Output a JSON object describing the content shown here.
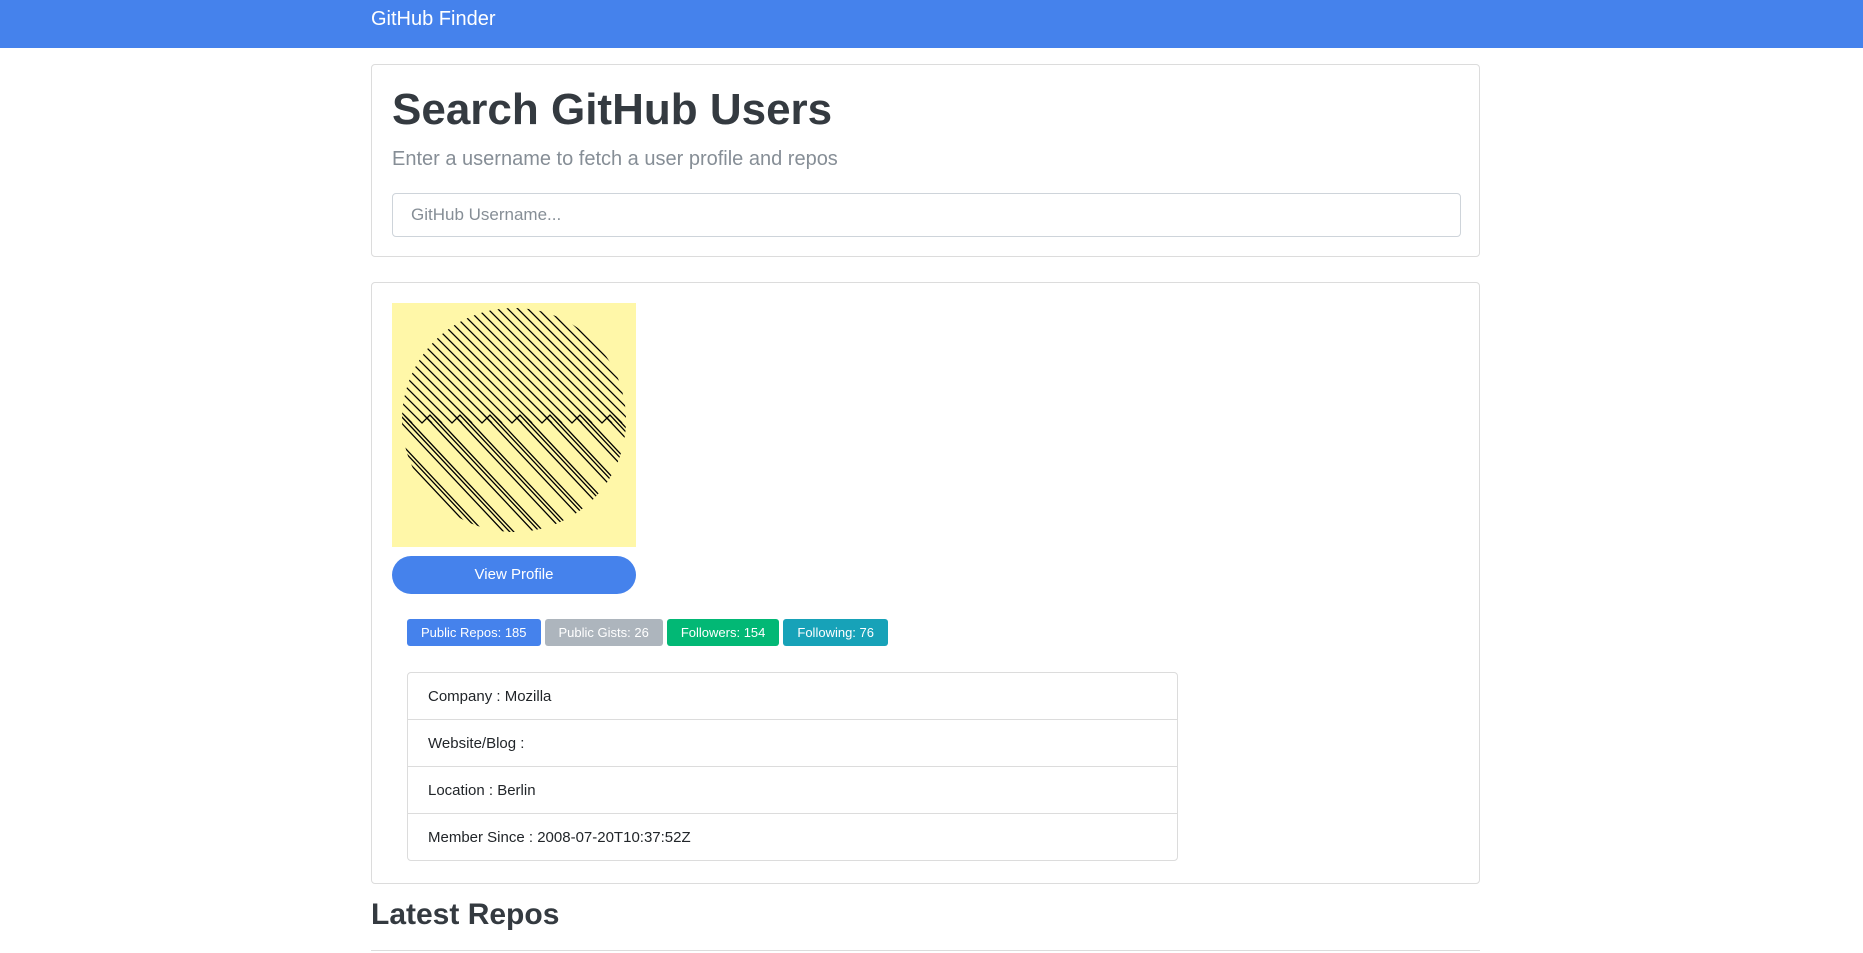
{
  "navbar": {
    "brand": "GitHub Finder",
    "color": "#4582ec"
  },
  "search": {
    "title": "Search GitHub Users",
    "subtitle": "Enter a username to fetch a user profile and repos",
    "placeholder": "GitHub Username...",
    "value": ""
  },
  "profile": {
    "avatar_icon": "identicon-maze-avatar",
    "view_profile_label": "View Profile",
    "badges": [
      {
        "label": "Public Repos: 185",
        "color": "#4582ec"
      },
      {
        "label": "Public Gists: 26",
        "color": "#adb5bd"
      },
      {
        "label": "Followers: 154",
        "color": "#02b875"
      },
      {
        "label": "Following: 76",
        "color": "#17a2b8"
      }
    ],
    "details": [
      "Company : Mozilla",
      "Website/Blog :",
      "Location : Berlin",
      "Member Since : 2008-07-20T10:37:52Z"
    ]
  },
  "repos": {
    "heading": "Latest Repos"
  }
}
